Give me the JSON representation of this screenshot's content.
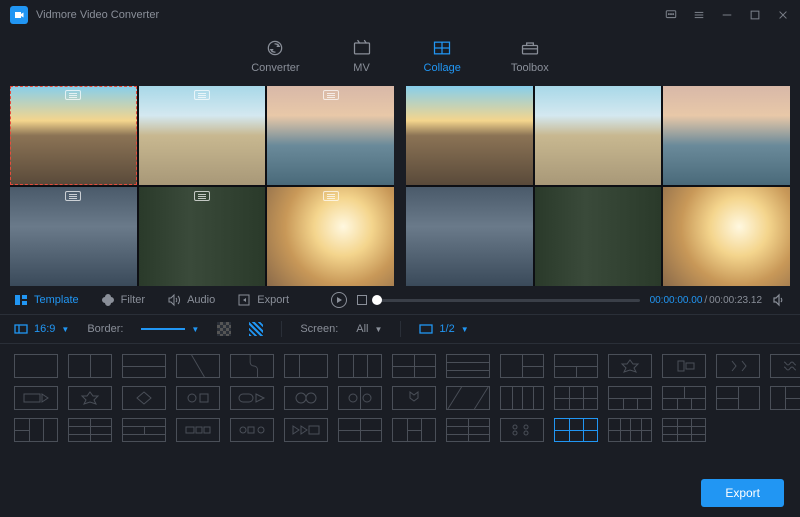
{
  "app_title": "Vidmore Video Converter",
  "nav": {
    "converter": "Converter",
    "mv": "MV",
    "collage": "Collage",
    "toolbox": "Toolbox"
  },
  "tabs": {
    "template": "Template",
    "filter": "Filter",
    "audio": "Audio",
    "export": "Export"
  },
  "player": {
    "current": "00:00:00.00",
    "sep": "/",
    "total": "00:00:23.12"
  },
  "options": {
    "aspect": "16:9",
    "border_label": "Border:",
    "screen_label": "Screen:",
    "screen_value": "All",
    "zoom": "1/2"
  },
  "footer": {
    "export": "Export"
  }
}
